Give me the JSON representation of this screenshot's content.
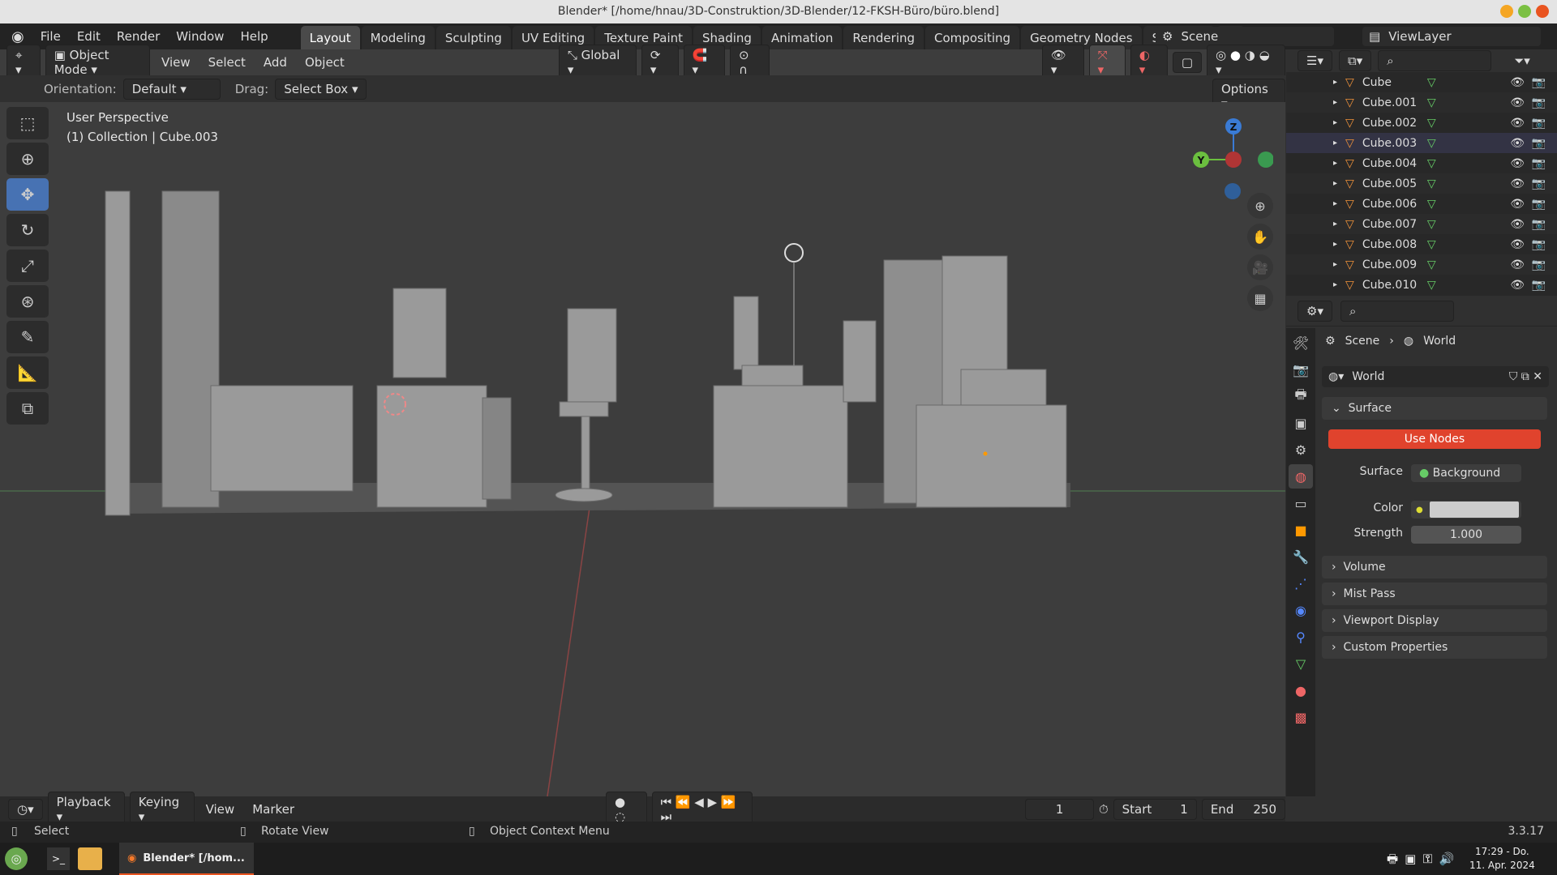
{
  "window": {
    "title": "Blender* [/home/hnau/3D-Construktion/3D-Blender/12-FKSH-Büro/büro.blend]"
  },
  "menu": [
    "File",
    "Edit",
    "Render",
    "Window",
    "Help"
  ],
  "workspaces": [
    "Layout",
    "Modeling",
    "Sculpting",
    "UV Editing",
    "Texture Paint",
    "Shading",
    "Animation",
    "Rendering",
    "Compositing",
    "Geometry Nodes",
    "Scripting"
  ],
  "scene": {
    "label": "Scene",
    "view_layer": "ViewLayer"
  },
  "header": {
    "mode": "Object Mode",
    "menus": [
      "View",
      "Select",
      "Add",
      "Object"
    ],
    "transform": "Global"
  },
  "tool_settings": {
    "orientation_label": "Orientation:",
    "orientation": "Default",
    "drag_label": "Drag:",
    "drag": "Select Box",
    "options": "Options"
  },
  "viewport": {
    "line1": "User Perspective",
    "line2": "(1) Collection | Cube.003",
    "gizmo": {
      "z": "Z",
      "y": "Y"
    }
  },
  "outliner": {
    "items": [
      "Cube",
      "Cube.001",
      "Cube.002",
      "Cube.003",
      "Cube.004",
      "Cube.005",
      "Cube.006",
      "Cube.007",
      "Cube.008",
      "Cube.009",
      "Cube.010"
    ],
    "selected": "Cube.003"
  },
  "properties": {
    "breadcrumb": [
      "Scene",
      "World"
    ],
    "world_name": "World",
    "surface_panel": "Surface",
    "use_nodes": "Use Nodes",
    "surface_label": "Surface",
    "surface_value": "Background",
    "color_label": "Color",
    "strength_label": "Strength",
    "strength_value": "1.000",
    "panels": [
      "Volume",
      "Mist Pass",
      "Viewport Display",
      "Custom Properties"
    ],
    "accent": "#e0432d"
  },
  "timeline": {
    "menus": [
      "Playback",
      "Keying",
      "View",
      "Marker"
    ],
    "current_frame": "1",
    "start_label": "Start",
    "start": "1",
    "end_label": "End",
    "end": "250"
  },
  "status": {
    "select": "Select",
    "rotate": "Rotate View",
    "context": "Object Context Menu",
    "version": "3.3.17"
  },
  "taskbar": {
    "app": "Blender* [/hom...",
    "time": "17:29 - Do.",
    "date": "11. Apr. 2024"
  }
}
